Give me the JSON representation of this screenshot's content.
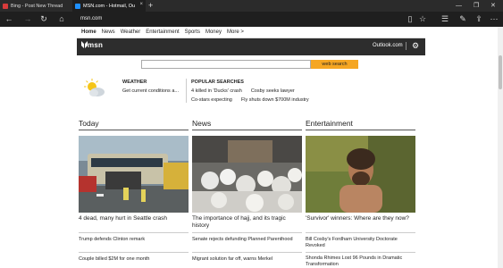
{
  "browser": {
    "tab1_title": "Bing - Post New Thread",
    "tab2_title": "MSN.com - Hotmail, Ou",
    "close_glyph": "×",
    "new_tab_glyph": "+",
    "address": "msn.com",
    "accent": "#1f1f1f"
  },
  "msn": {
    "menu": [
      "Home",
      "News",
      "Weather",
      "Entertainment",
      "Sports",
      "Money",
      "More >"
    ],
    "logo": "msn",
    "outlook": "Outlook.com",
    "search_button": "web search",
    "search_placeholder": "",
    "weather_title": "WEATHER",
    "weather_text": "Get current conditions a...",
    "popular_title": "POPULAR SEARCHES",
    "popular": [
      [
        "4 killed in 'Ducks' crash",
        "Cosby seeks lawyer"
      ],
      [
        "Co-stars expecting",
        "Fly shuts down $700M industry"
      ]
    ]
  },
  "columns": [
    {
      "heading": "Today",
      "headline": "4 dead, many hurt in Seattle crash",
      "subs": [
        "Trump defends Clinton remark",
        "Couple billed $2M for one month"
      ]
    },
    {
      "heading": "News",
      "headline": "The importance of hajj, and its tragic history",
      "subs": [
        "Senate rejects defunding Planned Parenthood",
        "Migrant solution far off, warns Merkel"
      ]
    },
    {
      "heading": "Entertainment",
      "headline": "'Survivor' winners: Where are they now?",
      "subs": [
        "Bill Cosby's Fordham University Doctorate Revoked",
        "Shonda Rhimes Lost 96 Pounds in Dramatic Transformation"
      ]
    }
  ]
}
